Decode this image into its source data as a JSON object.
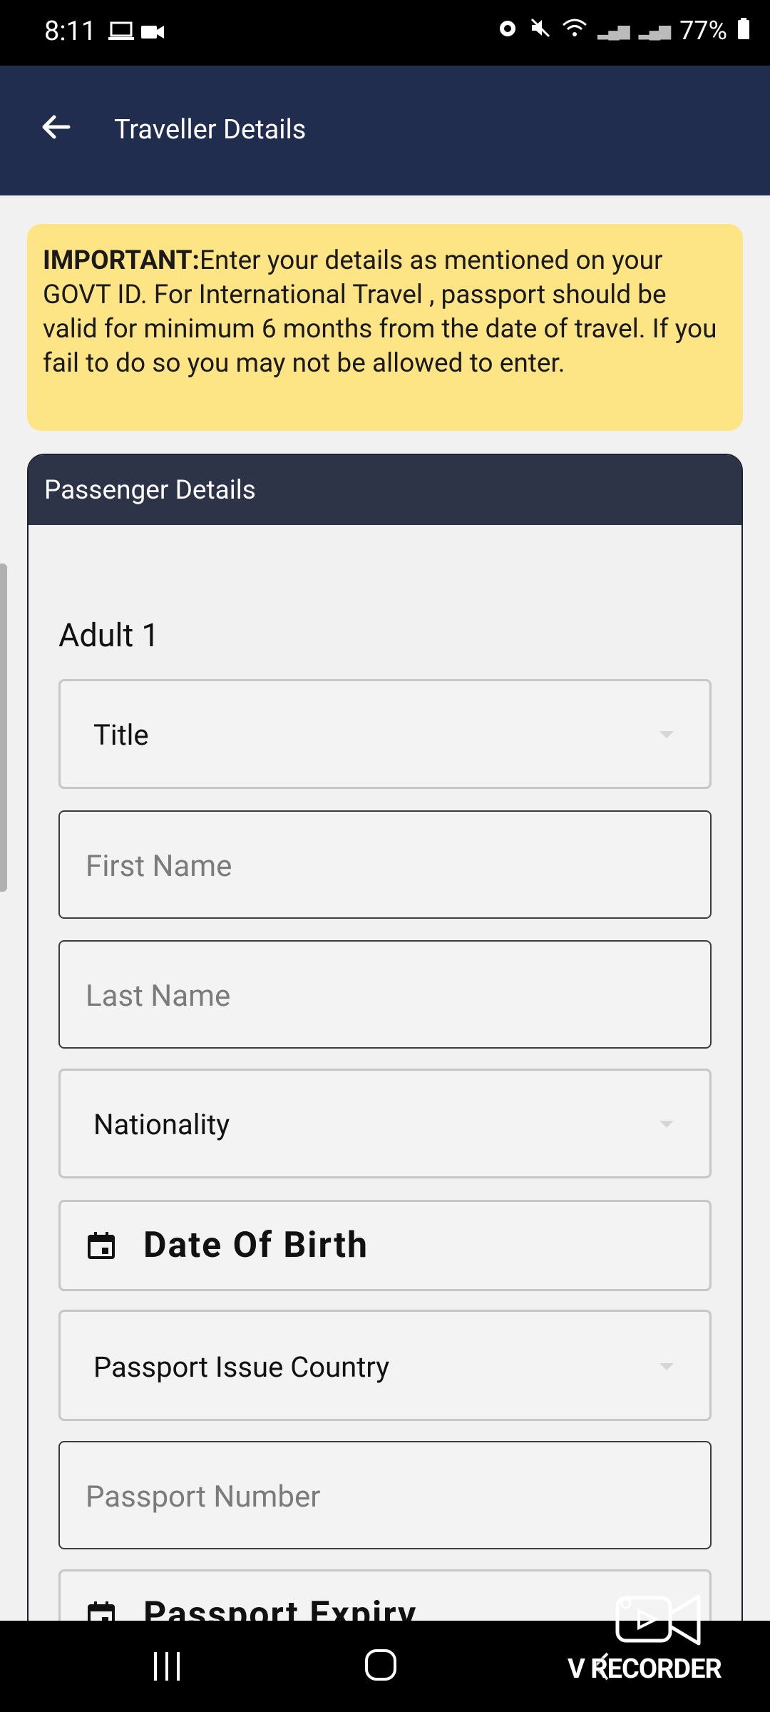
{
  "status_bar": {
    "time": "8:11",
    "battery": "77%"
  },
  "app_bar": {
    "title": "Traveller Details"
  },
  "notice": {
    "bold_prefix": "IMPORTANT:",
    "text": "Enter your details as mentioned on your GOVT ID. For International Travel , passport should be valid for minimum 6 months from the date of travel. If you fail to do so you may not be allowed to enter."
  },
  "passenger_card": {
    "header": "Passenger Details",
    "adult_label": "Adult 1",
    "title_dropdown": "Title",
    "first_name_placeholder": "First Name",
    "last_name_placeholder": "Last Name",
    "nationality_dropdown": "Nationality",
    "dob_label": "Date Of Birth",
    "passport_country_dropdown": "Passport Issue Country",
    "passport_number_placeholder": "Passport Number",
    "passport_expiry_label": "Passport Expiry"
  },
  "watermark": {
    "text": "V RECORDER"
  },
  "colors": {
    "app_bar": "#202d4e",
    "card_header": "#2e3447",
    "notice_bg": "#fde484",
    "page_bg": "#f1f1f1"
  }
}
